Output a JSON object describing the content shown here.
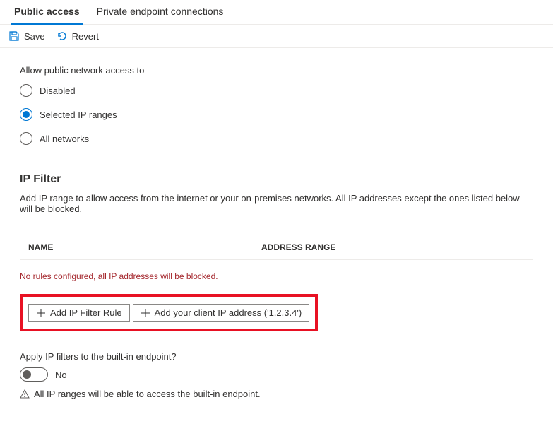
{
  "tabs": {
    "public_access": "Public access",
    "private_endpoint": "Private endpoint connections"
  },
  "toolbar": {
    "save": "Save",
    "revert": "Revert"
  },
  "access": {
    "label": "Allow public network access to",
    "options": {
      "disabled": "Disabled",
      "selected_ip": "Selected IP ranges",
      "all_networks": "All networks"
    }
  },
  "ip_filter": {
    "heading": "IP Filter",
    "description": "Add IP range to allow access from the internet or your on-premises networks. All IP addresses except the ones listed below will be blocked.",
    "columns": {
      "name": "NAME",
      "address_range": "ADDRESS RANGE"
    },
    "empty_message": "No rules configured, all IP addresses will be blocked.",
    "add_rule": "Add IP Filter Rule",
    "add_client_ip": "Add your client IP address ('1.2.3.4')"
  },
  "apply_filters": {
    "label": "Apply IP filters to the built-in endpoint?",
    "value": "No",
    "warning": "All IP ranges will be able to access the built-in endpoint."
  }
}
